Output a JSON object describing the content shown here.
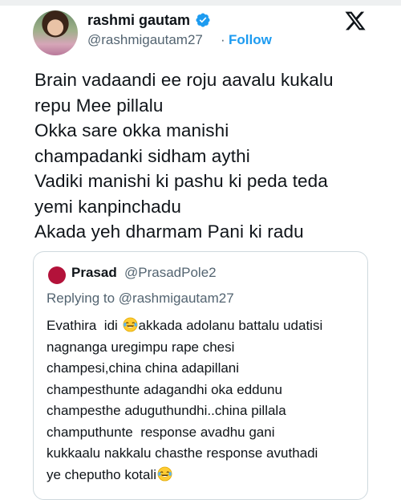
{
  "author": {
    "name": "rashmi gautam",
    "handle": "@rashmigautam27",
    "separator": "·",
    "follow_label": "Follow",
    "verified_icon": "verified-badge-icon",
    "verified_color": "#1d9bf0"
  },
  "platform_logo": "x-logo-icon",
  "tweet": {
    "lines": [
      "Brain vadaandi ee roju aavalu kukalu",
      "repu Mee pillalu",
      "Okka sare okka manishi",
      "champadanki sidham aythi",
      "Vadiki manishi ki pashu ki peda teda",
      "yemi kanpinchadu",
      "Akada yeh dharmam Pani ki radu"
    ]
  },
  "quoted": {
    "name": "Prasad",
    "handle": "@PrasadPole2",
    "replying_to": "Replying to @rashmigautam27",
    "line1_a": "Evathira  idi ",
    "line1_b": "akkada adolanu battalu udatisi",
    "lines": [
      "nagnanga uregimpu rape chesi",
      "champesi,china china adapillani",
      "champesthunte adagandhi oka eddunu",
      "champesthe aduguthundhi..china pillala",
      "champuthunte  response avadhu gani",
      "kukkaalu nakkalu chasthe response avuthadi"
    ],
    "last_line": "ye cheputho kotali",
    "emoji": "laughing-tears-emoji-icon"
  },
  "colors": {
    "text": "#0f1419",
    "secondary": "#536471",
    "link": "#1d9bf0",
    "border": "#cfd9de",
    "quote_avatar": "#b3123a"
  }
}
